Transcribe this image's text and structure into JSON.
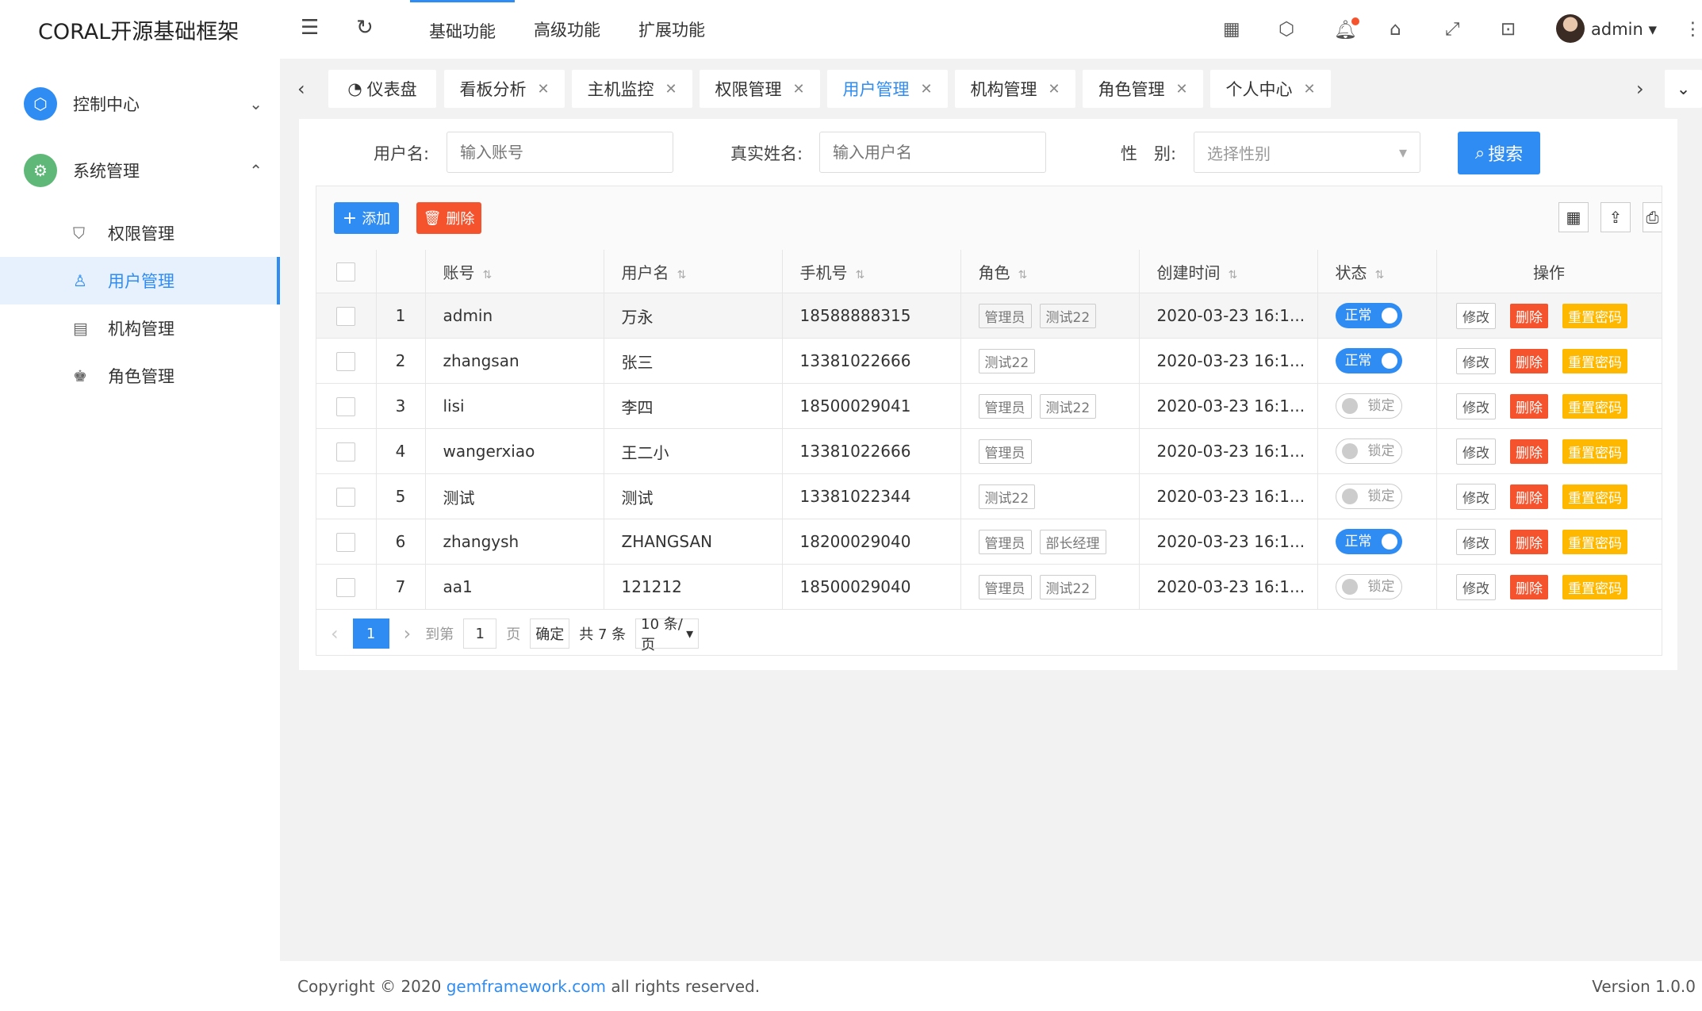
{
  "app": {
    "title": "CORAL开源基础框架"
  },
  "sidebar": {
    "groups": [
      {
        "label": "控制中心",
        "icon": "cube-icon",
        "color": "#2f8cf3"
      },
      {
        "label": "系统管理",
        "icon": "gear-icon",
        "color": "#5fb878"
      }
    ],
    "items": [
      {
        "label": "权限管理",
        "icon": "shield-icon"
      },
      {
        "label": "用户管理",
        "icon": "user-icon"
      },
      {
        "label": "机构管理",
        "icon": "calendar-icon"
      },
      {
        "label": "角色管理",
        "icon": "users-icon"
      }
    ]
  },
  "header": {
    "nav": [
      "基础功能",
      "高级功能",
      "扩展功能"
    ],
    "user": "admin"
  },
  "tabs": [
    {
      "label": "仪表盘",
      "icon": "dashboard-icon"
    },
    {
      "label": "看板分析"
    },
    {
      "label": "主机监控"
    },
    {
      "label": "权限管理"
    },
    {
      "label": "用户管理"
    },
    {
      "label": "机构管理"
    },
    {
      "label": "角色管理"
    },
    {
      "label": "个人中心"
    }
  ],
  "filters": {
    "username_label": "用户名:",
    "username_placeholder": "输入账号",
    "realname_label": "真实姓名:",
    "realname_placeholder": "输入用户名",
    "gender_label": "性　别:",
    "gender_placeholder": "选择性别",
    "search_label": "搜索"
  },
  "toolbar": {
    "add_label": "添加",
    "delete_label": "删除"
  },
  "table": {
    "columns": [
      "账号",
      "用户名",
      "手机号",
      "角色",
      "创建时间",
      "状态",
      "操作"
    ],
    "rows": [
      {
        "no": "1",
        "account": "admin",
        "name": "万永",
        "phone": "18588888315",
        "roles": [
          "管理员",
          "测试22"
        ],
        "created": "2020-03-23 16:1...",
        "status": "正常",
        "on": true
      },
      {
        "no": "2",
        "account": "zhangsan",
        "name": "张三",
        "phone": "13381022666",
        "roles": [
          "测试22"
        ],
        "created": "2020-03-23 16:1...",
        "status": "正常",
        "on": true
      },
      {
        "no": "3",
        "account": "lisi",
        "name": "李四",
        "phone": "18500029041",
        "roles": [
          "管理员",
          "测试22"
        ],
        "created": "2020-03-23 16:1...",
        "status": "锁定",
        "on": false
      },
      {
        "no": "4",
        "account": "wangerxiao",
        "name": "王二小",
        "phone": "13381022666",
        "roles": [
          "管理员"
        ],
        "created": "2020-03-23 16:1...",
        "status": "锁定",
        "on": false
      },
      {
        "no": "5",
        "account": "测试",
        "name": "测试",
        "phone": "13381022344",
        "roles": [
          "测试22"
        ],
        "created": "2020-03-23 16:1...",
        "status": "锁定",
        "on": false
      },
      {
        "no": "6",
        "account": "zhangysh",
        "name": "ZHANGSAN",
        "phone": "18200029040",
        "roles": [
          "管理员",
          "部长经理"
        ],
        "created": "2020-03-23 16:1...",
        "status": "正常",
        "on": true
      },
      {
        "no": "7",
        "account": "aa1",
        "name": "121212",
        "phone": "18500029040",
        "roles": [
          "管理员",
          "测试22"
        ],
        "created": "2020-03-23 16:1...",
        "status": "锁定",
        "on": false
      }
    ],
    "actions": {
      "edit": "修改",
      "delete": "删除",
      "reset": "重置密码"
    }
  },
  "pager": {
    "current": "1",
    "goto_label": "到第",
    "goto_value": "1",
    "page_unit": "页",
    "confirm": "确定",
    "total": "共 7 条",
    "page_size": "10 条/页"
  },
  "footer": {
    "prefix": "Copyright © 2020 ",
    "link": "gemframework.com",
    "suffix": " all rights reserved.",
    "version": "Version 1.0.0"
  },
  "colors": {
    "primary": "#2f8cf3",
    "danger": "#f5532d",
    "warning": "#ffb800",
    "success": "#5fb878"
  }
}
